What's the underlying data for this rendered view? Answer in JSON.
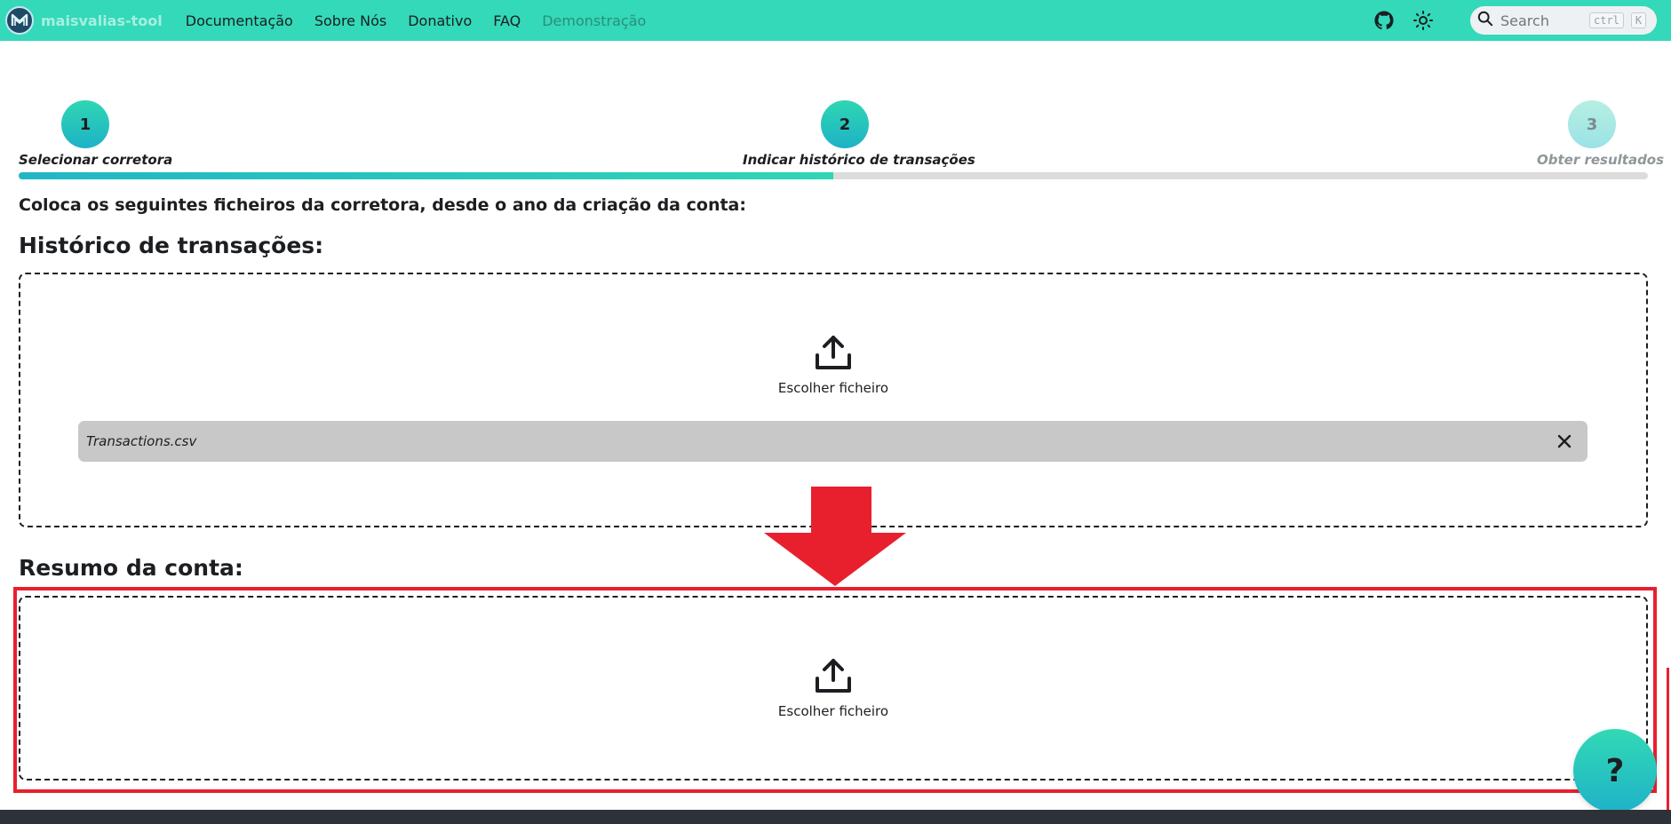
{
  "navbar": {
    "brand": "maisvalias-tool",
    "links": [
      "Documentação",
      "Sobre Nós",
      "Donativo",
      "FAQ",
      "Demonstração"
    ],
    "search_placeholder": "Search",
    "kbd_ctrl": "ctrl",
    "kbd_k": "K"
  },
  "stepper": {
    "steps": [
      {
        "number": "1",
        "label": "Selecionar corretora",
        "state": "completed"
      },
      {
        "number": "2",
        "label": "Indicar histórico de transações",
        "state": "current"
      },
      {
        "number": "3",
        "label": "Obter resultados",
        "state": "pending"
      }
    ],
    "progress_percent": 50
  },
  "instructions": "Coloca os seguintes ficheiros da corretora, desde o ano da criação da conta:",
  "sections": {
    "transactions": {
      "title": "Histórico de transações:",
      "upload_label": "Escolher ficheiro",
      "files": [
        "Transactions.csv"
      ]
    },
    "account_summary": {
      "title": "Resumo da conta:",
      "upload_label": "Escolher ficheiro"
    }
  },
  "help_button": "?",
  "colors": {
    "navbar": "#33d9b8",
    "accent": "#1eb2c6",
    "annotation": "#e8202e"
  }
}
